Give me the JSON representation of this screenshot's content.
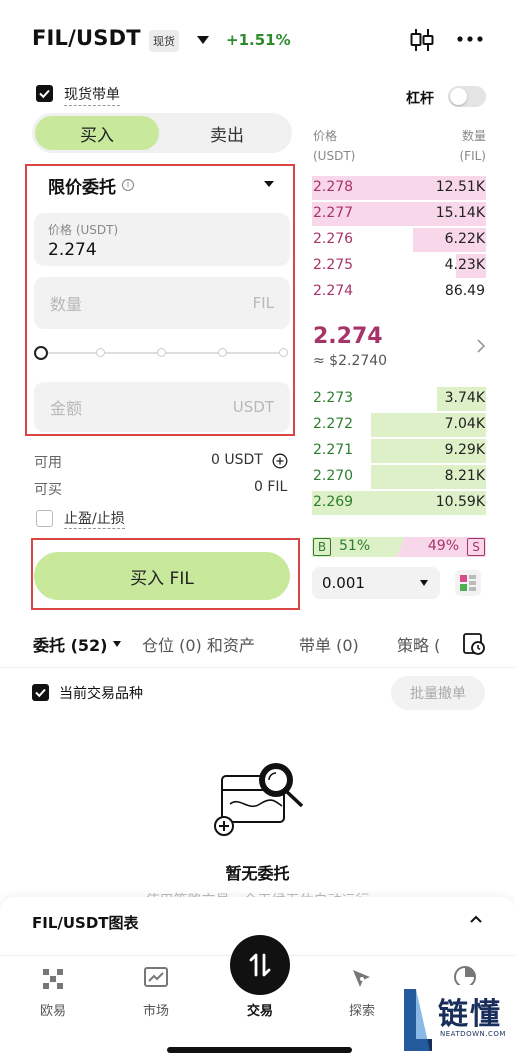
{
  "header": {
    "pair": "FIL/USDT",
    "market_badge": "现货",
    "change": "+1.51%"
  },
  "options": {
    "spot_copy_label": "现货带单",
    "leverage_label": "杠杆"
  },
  "trade_tabs": {
    "buy": "买入",
    "sell": "卖出"
  },
  "order_form": {
    "order_type": "限价委托",
    "price_label": "价格 (USDT)",
    "price_value": "2.274",
    "quantity_placeholder": "数量",
    "quantity_unit": "FIL",
    "amount_placeholder": "金额",
    "amount_unit": "USDT",
    "available_label": "可用",
    "available_value": "0 USDT",
    "can_buy_label": "可买",
    "can_buy_value": "0 FIL",
    "tpsl_label": "止盈/止损",
    "submit_label": "买入 FIL",
    "slider_level": 0
  },
  "orderbook": {
    "price_header": "价格",
    "price_unit": "(USDT)",
    "qty_header": "数量",
    "qty_unit": "(FIL)",
    "asks": [
      {
        "price": "2.278",
        "qty": "12.51K",
        "depth": 1.0
      },
      {
        "price": "2.277",
        "qty": "15.14K",
        "depth": 1.0
      },
      {
        "price": "2.276",
        "qty": "6.22K",
        "depth": 0.42
      },
      {
        "price": "2.275",
        "qty": "4.23K",
        "depth": 0.17
      },
      {
        "price": "2.274",
        "qty": "86.49",
        "depth": 0.0
      }
    ],
    "last_price": "2.274",
    "last_price_usd": "≈ $2.2740",
    "bids": [
      {
        "price": "2.273",
        "qty": "3.74K",
        "depth": 0.28
      },
      {
        "price": "2.272",
        "qty": "7.04K",
        "depth": 0.66
      },
      {
        "price": "2.271",
        "qty": "9.29K",
        "depth": 0.66
      },
      {
        "price": "2.270",
        "qty": "8.21K",
        "depth": 0.66
      },
      {
        "price": "2.269",
        "qty": "10.59K",
        "depth": 1.0
      }
    ],
    "buy_ratio_badge": "B",
    "buy_ratio": "51%",
    "sell_ratio": "49%",
    "sell_ratio_badge": "S",
    "buy_ratio_value": 51,
    "depth_precision": "0.001",
    "colors": {
      "ask": "#a73468",
      "bid": "#2e7d2e",
      "ask_bg": "#f8d7ea",
      "bid_bg": "#ddf0c8"
    }
  },
  "bottom_tabs": {
    "orders": "委托 (52)",
    "positions": "仓位 (0) 和资产",
    "copy": "带单 (0)",
    "strategy": "策略 ("
  },
  "orders_panel": {
    "current_pair_label": "当前交易品种",
    "batch_cancel": "批量撤单",
    "empty_title": "暂无委托",
    "empty_sub": "使用策略交易，全天候无休自动运行"
  },
  "chart_panel": {
    "title": "FIL/USDT图表"
  },
  "nav": {
    "items": [
      "欧易",
      "市场",
      "交易",
      "探索",
      "资产"
    ]
  },
  "watermark": {
    "brand_cn": "链懂",
    "brand_en": "NEATDOWN.COM"
  }
}
